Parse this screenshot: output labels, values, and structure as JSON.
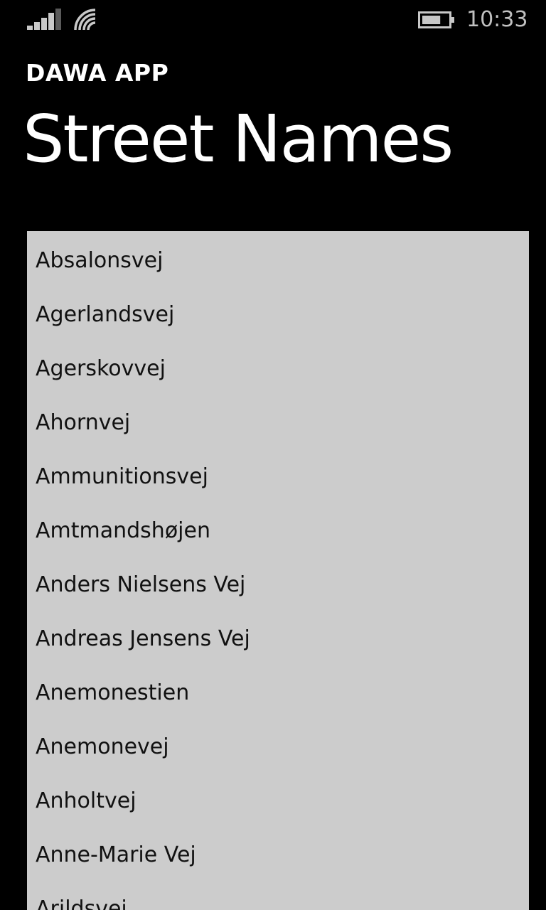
{
  "status_bar": {
    "time": "10:33",
    "signal_icon": "cellular-signal-icon",
    "wifi_icon": "wifi-icon",
    "battery_icon": "battery-icon",
    "battery_level": 0.72
  },
  "header": {
    "app_name": "DAWA APP",
    "page_title": "Street Names"
  },
  "street_list": {
    "items": [
      "Absalonsvej",
      "Agerlandsvej",
      "Agerskovvej",
      "Ahornvej",
      "Ammunitionsvej",
      "Amtmandshøjen",
      "Anders Nielsens Vej",
      "Andreas Jensens Vej",
      "Anemonestien",
      "Anemonevej",
      "Anholtvej",
      "Anne-Marie Vej",
      "Arildsvej"
    ]
  },
  "colors": {
    "background": "#000000",
    "list_background": "#cccccc",
    "list_text": "#111111",
    "header_text": "#ffffff"
  }
}
